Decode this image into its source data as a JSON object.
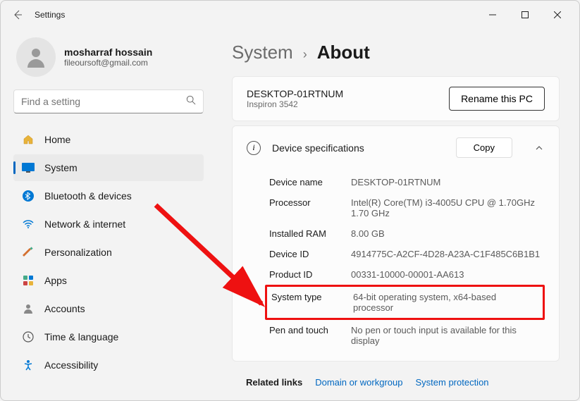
{
  "titlebar": {
    "app_title": "Settings"
  },
  "profile": {
    "name": "mosharraf hossain",
    "email": "fileoursoft@gmail.com"
  },
  "search": {
    "placeholder": "Find a setting"
  },
  "nav": [
    {
      "label": "Home",
      "icon": "home"
    },
    {
      "label": "System",
      "icon": "system",
      "active": true
    },
    {
      "label": "Bluetooth & devices",
      "icon": "bluetooth"
    },
    {
      "label": "Network & internet",
      "icon": "network"
    },
    {
      "label": "Personalization",
      "icon": "personalization"
    },
    {
      "label": "Apps",
      "icon": "apps"
    },
    {
      "label": "Accounts",
      "icon": "accounts"
    },
    {
      "label": "Time & language",
      "icon": "time"
    },
    {
      "label": "Accessibility",
      "icon": "accessibility"
    }
  ],
  "breadcrumb": {
    "parent": "System",
    "current": "About"
  },
  "device": {
    "name": "DESKTOP-01RTNUM",
    "model": "Inspiron 3542",
    "rename_label": "Rename this PC"
  },
  "specs_card": {
    "title": "Device specifications",
    "copy_label": "Copy"
  },
  "specs": [
    {
      "label": "Device name",
      "value": "DESKTOP-01RTNUM"
    },
    {
      "label": "Processor",
      "value": "Intel(R) Core(TM) i3-4005U CPU @ 1.70GHz   1.70 GHz"
    },
    {
      "label": "Installed RAM",
      "value": "8.00 GB"
    },
    {
      "label": "Device ID",
      "value": "4914775C-A2CF-4D28-A23A-C1F485C6B1B1"
    },
    {
      "label": "Product ID",
      "value": "00331-10000-00001-AA613"
    },
    {
      "label": "System type",
      "value": "64-bit operating system, x64-based processor",
      "highlight": true
    },
    {
      "label": "Pen and touch",
      "value": "No pen or touch input is available for this display"
    }
  ],
  "related": {
    "label": "Related links",
    "links": [
      "Domain or workgroup",
      "System protection"
    ]
  },
  "colors": {
    "accent": "#0067c0",
    "highlight_border": "#e11"
  }
}
